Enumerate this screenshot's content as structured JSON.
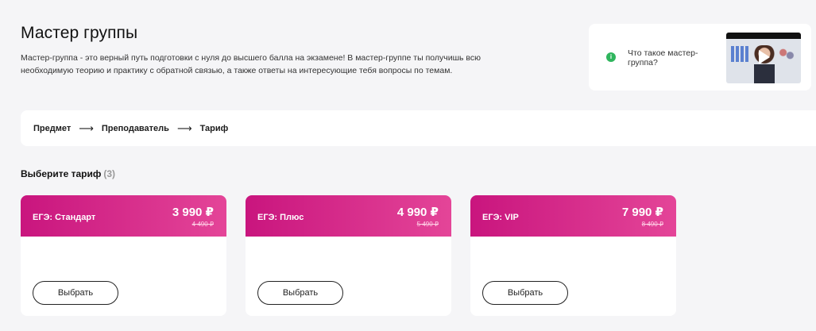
{
  "header": {
    "title": "Мастер группы",
    "description": "Мастер-группа - это верный путь подготовки с нуля до высшего балла на экзамене! В мастер-группе ты получишь всю необходимую теорию и практику с обратной связью, а также ответы на интересующие тебя вопросы по темам."
  },
  "video": {
    "label": "Что такое мастер-группа?",
    "info_glyph": "i"
  },
  "steps": [
    {
      "label": "Предмет"
    },
    {
      "label": "Преподаватель"
    },
    {
      "label": "Тариф"
    }
  ],
  "step_arrow": "⟶",
  "tariffs": {
    "title": "Выберите тариф",
    "count": "(3)",
    "plans": [
      {
        "name": "ЕГЭ: Стандарт",
        "price": "3 990 ₽",
        "old_price": "4 490 ₽",
        "button": "Выбрать"
      },
      {
        "name": "ЕГЭ: Плюс",
        "price": "4 990 ₽",
        "old_price": "5 490 ₽",
        "button": "Выбрать"
      },
      {
        "name": "ЕГЭ: VIP",
        "price": "7 990 ₽",
        "old_price": "8 490 ₽",
        "button": "Выбрать"
      }
    ]
  },
  "colors": {
    "accent_start": "#c9157e",
    "accent_end": "#e44598",
    "info_green": "#2fb55d"
  }
}
